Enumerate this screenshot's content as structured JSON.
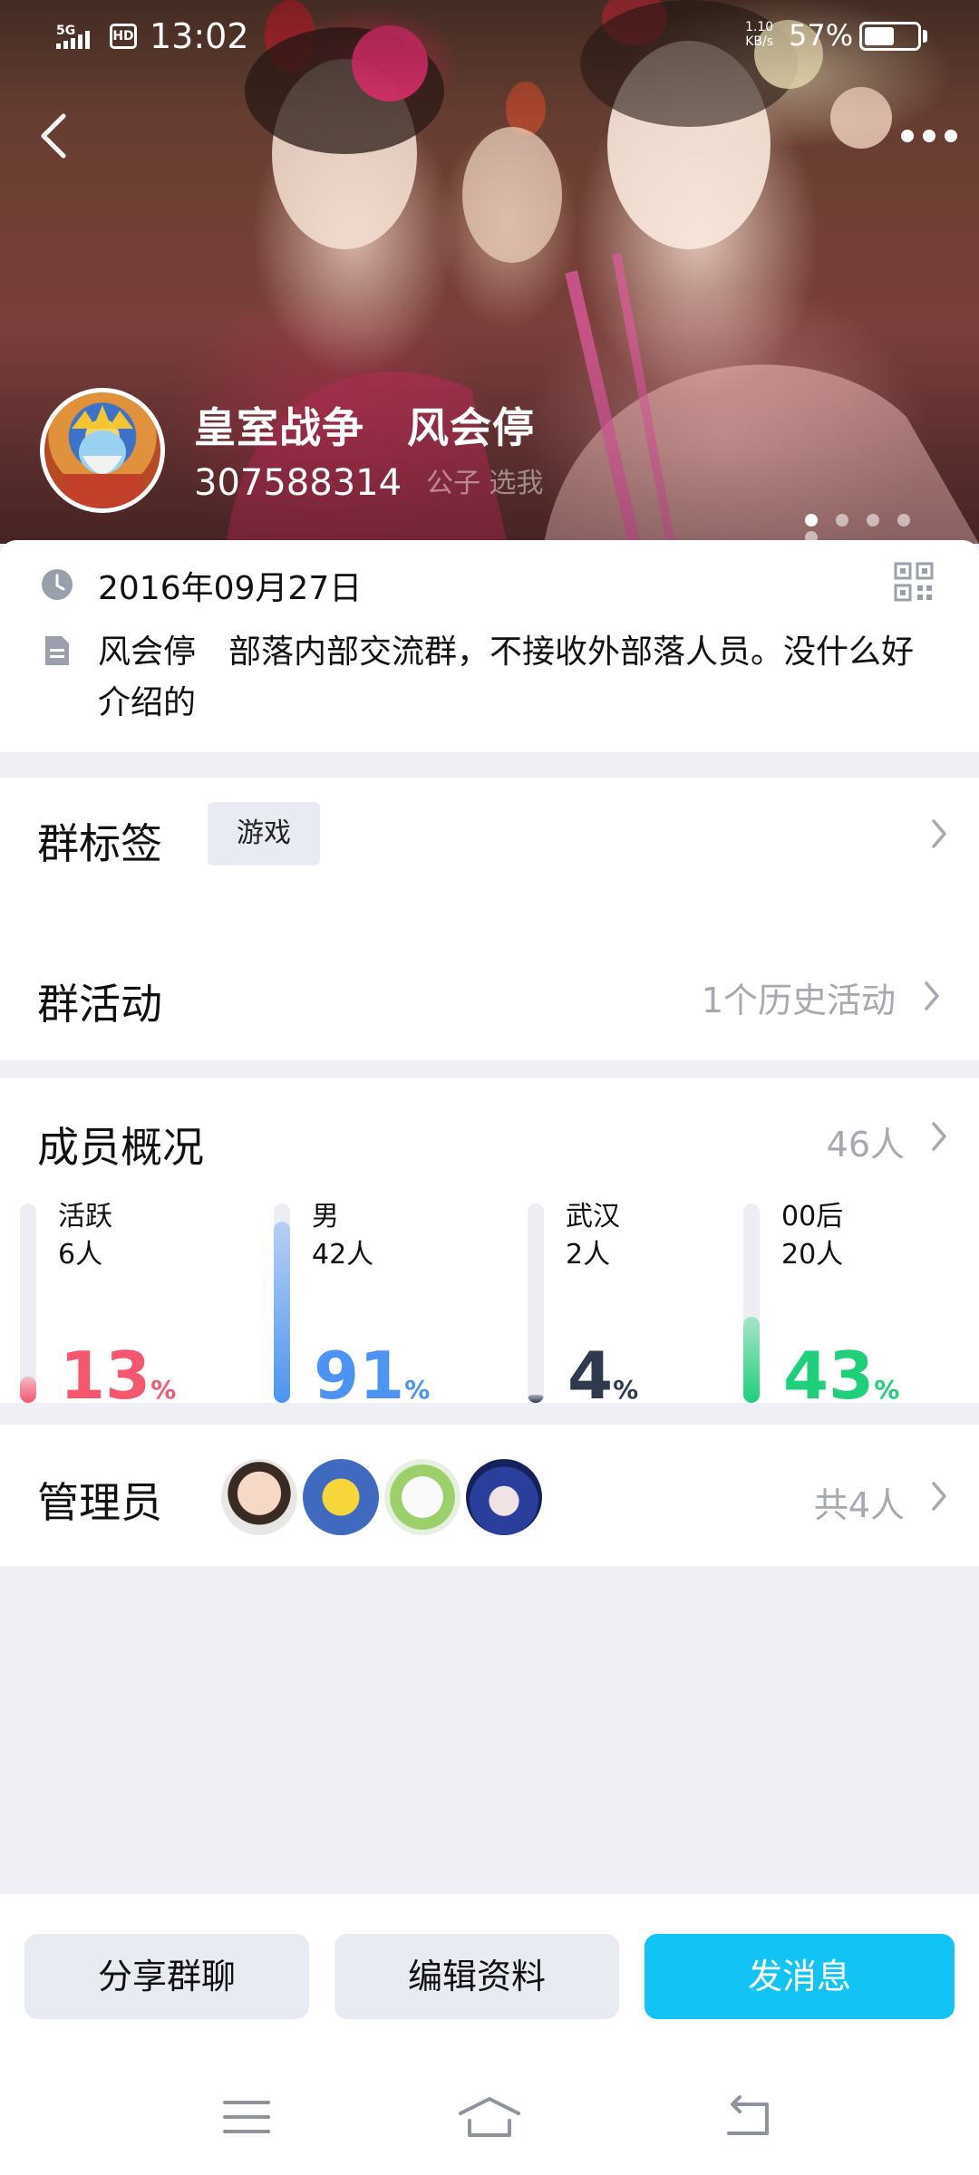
{
  "status_bar": {
    "network": "5G",
    "hd": "HD",
    "time": "13:02",
    "net_speed_value": "1.10",
    "net_speed_unit": "KB/s",
    "battery_pct": "57%",
    "battery_level": 0.57
  },
  "header": {
    "group_name": "皇室战争　风会停",
    "group_id": "307588314",
    "photo_caption": "公子 选我",
    "carousel_count": 5,
    "carousel_active": 0
  },
  "info": {
    "created_date": "2016年09月27日",
    "description": "风会停　部落内部交流群，不接收外部落人员。没什么好介绍的"
  },
  "tags_section": {
    "title": "群标签",
    "tag": "游戏"
  },
  "activity_section": {
    "title": "群活动",
    "summary": "1个历史活动"
  },
  "members_section": {
    "title": "成员概况",
    "total": "46人",
    "stats": [
      {
        "label": "活跃",
        "count": "6人",
        "value": "13",
        "pct": "%",
        "fraction": 0.13,
        "color": "#f6566e"
      },
      {
        "label": "男",
        "count": "42人",
        "value": "91",
        "pct": "%",
        "fraction": 0.91,
        "color": "#4d93f3"
      },
      {
        "label": "武汉",
        "count": "2人",
        "value": "4",
        "pct": "%",
        "fraction": 0.04,
        "color": "#2f3a4f"
      },
      {
        "label": "00后",
        "count": "20人",
        "value": "43",
        "pct": "%",
        "fraction": 0.43,
        "color": "#1fcf79"
      }
    ]
  },
  "admins_section": {
    "title": "管理员",
    "total": "共4人"
  },
  "actions": {
    "share": "分享群聊",
    "edit": "编辑资料",
    "send": "发消息"
  },
  "colors": {
    "accent": "#12c4f6",
    "muted": "#a6a9b2",
    "page_bg": "#eef0f5"
  },
  "icons": [
    "back-icon",
    "more-icon",
    "clock-icon",
    "qr-code-icon",
    "document-icon",
    "chevron-right-icon",
    "menu-icon",
    "home-icon",
    "back-nav-icon"
  ]
}
